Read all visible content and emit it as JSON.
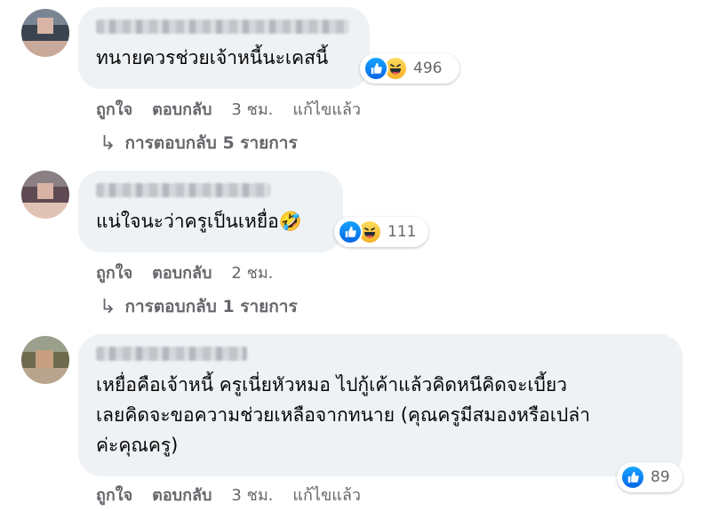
{
  "comments": [
    {
      "text": "ทนายควรช่วยเจ้าหนี้นะเคสนี้",
      "reaction_count": "496",
      "actions": {
        "like": "ถูกใจ",
        "reply": "ตอบกลับ",
        "time": "3 ชม.",
        "edited": "แก้ไขแล้ว"
      },
      "replies": "การตอบกลับ 5 รายการ",
      "reactions": [
        "like-icon",
        "haha-icon"
      ]
    },
    {
      "text": "แน่ใจนะว่าครูเป็นเหยื่อ🤣",
      "reaction_count": "111",
      "actions": {
        "like": "ถูกใจ",
        "reply": "ตอบกลับ",
        "time": "2 ชม."
      },
      "replies": "การตอบกลับ 1 รายการ",
      "reactions": [
        "like-icon",
        "haha-icon"
      ]
    },
    {
      "text": "เหยื่อคือเจ้าหนี้ ครูเนี่ยหัวหมอ ไปกู้เค้าแล้วคิดหนีคิดจะเบี้ยว\nเลยคิดจะขอความช่วยเหลือจากทนาย (คุณครูมีสมองหรือเปล่า\nค่ะคุณครู)",
      "reaction_count": "89",
      "actions": {
        "like": "ถูกใจ",
        "reply": "ตอบกลับ",
        "time": "3 ชม.",
        "edited": "แก้ไขแล้ว"
      },
      "reactions": [
        "like-icon"
      ]
    }
  ],
  "colors": {
    "bubble": "#eff2f5",
    "like": "#1877f2",
    "haha": "#f7b125",
    "meta": "#65676b"
  }
}
